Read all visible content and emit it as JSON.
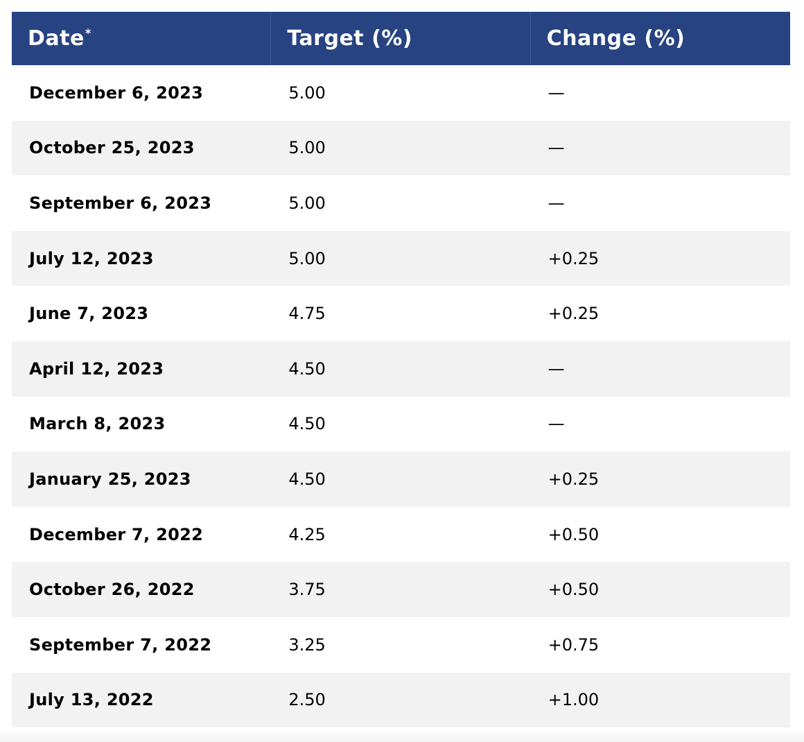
{
  "table": {
    "headers": {
      "date": "Date",
      "date_footnote_mark": "*",
      "target": "Target (%)",
      "change": "Change (%)"
    },
    "rows": [
      {
        "date": "December 6, 2023",
        "target": "5.00",
        "change": "—"
      },
      {
        "date": "October 25, 2023",
        "target": "5.00",
        "change": "—"
      },
      {
        "date": "September 6, 2023",
        "target": "5.00",
        "change": "—"
      },
      {
        "date": "July 12, 2023",
        "target": "5.00",
        "change": "+0.25"
      },
      {
        "date": "June 7, 2023",
        "target": "4.75",
        "change": "+0.25"
      },
      {
        "date": "April 12, 2023",
        "target": "4.50",
        "change": "—"
      },
      {
        "date": "March 8, 2023",
        "target": "4.50",
        "change": "—"
      },
      {
        "date": "January 25, 2023",
        "target": "4.50",
        "change": "+0.25"
      },
      {
        "date": "December 7, 2022",
        "target": "4.25",
        "change": "+0.50"
      },
      {
        "date": "October 26, 2022",
        "target": "3.75",
        "change": "+0.50"
      },
      {
        "date": "September 7, 2022",
        "target": "3.25",
        "change": "+0.75"
      },
      {
        "date": "July 13, 2022",
        "target": "2.50",
        "change": "+1.00"
      }
    ]
  },
  "colors": {
    "header_bg": "#274381",
    "header_text": "#ffffff",
    "row_alt_bg": "#f2f2f2",
    "row_bg": "#ffffff"
  }
}
